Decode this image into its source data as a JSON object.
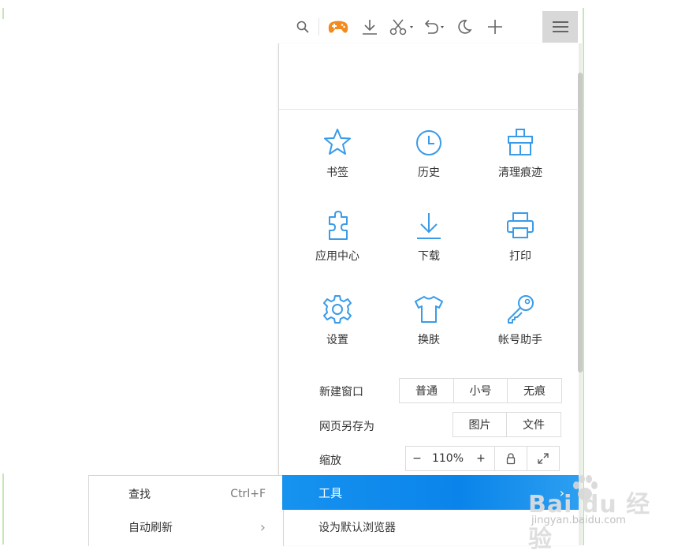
{
  "toolbar": {
    "icons": [
      "search-icon",
      "game-controller-icon",
      "download-icon",
      "scissors-icon",
      "undo-icon",
      "night-mode-icon",
      "new-tab-icon",
      "menu-icon"
    ],
    "accent": "#f28a1e"
  },
  "grid": [
    {
      "label": "书签",
      "icon": "star-icon"
    },
    {
      "label": "历史",
      "icon": "clock-icon"
    },
    {
      "label": "清理痕迹",
      "icon": "broom-icon"
    },
    {
      "label": "应用中心",
      "icon": "puzzle-icon"
    },
    {
      "label": "下载",
      "icon": "download-icon"
    },
    {
      "label": "打印",
      "icon": "printer-icon"
    },
    {
      "label": "设置",
      "icon": "gear-icon"
    },
    {
      "label": "换肤",
      "icon": "tshirt-icon"
    },
    {
      "label": "帐号助手",
      "icon": "key-icon"
    }
  ],
  "new_window": {
    "label": "新建窗口",
    "options": [
      "普通",
      "小号",
      "无痕"
    ]
  },
  "save_as": {
    "label": "网页另存为",
    "options": [
      "图片",
      "文件"
    ]
  },
  "zoom": {
    "label": "缩放",
    "minus": "−",
    "value": "110%",
    "plus": "+"
  },
  "menu": {
    "tools": "工具",
    "tools_arrow": "›",
    "set_default": "设为默认浏览器",
    "find": "查找",
    "find_shortcut": "Ctrl+F",
    "auto_refresh": "自动刷新",
    "auto_refresh_arrow": "›"
  },
  "watermark": {
    "brand": "Bai du 经验",
    "url": "jingyan.baidu.com"
  },
  "colors": {
    "icon_blue": "#3a9be8",
    "highlight": "#0a84ea"
  }
}
